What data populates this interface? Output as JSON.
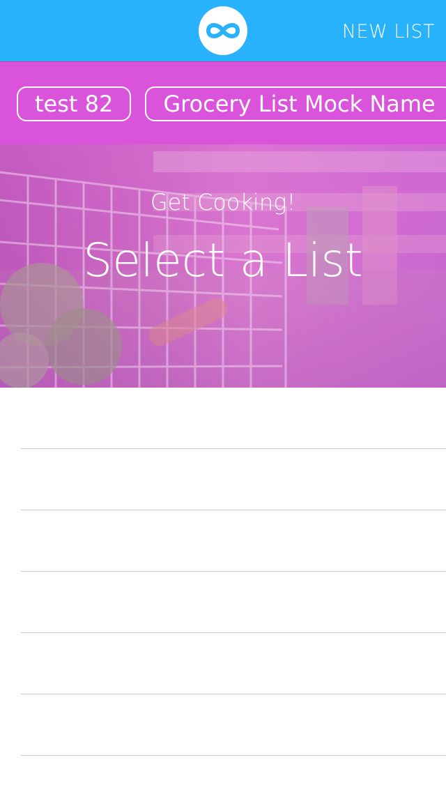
{
  "header": {
    "new_list_label": "NEW LIST",
    "logo_icon": "infinity-icon",
    "background_color": "#27b2fb"
  },
  "chips": {
    "background_color": "#d954db",
    "items": [
      {
        "label": "test 82"
      },
      {
        "label": "Grocery List Mock Name"
      }
    ]
  },
  "hero": {
    "subtitle": "Get Cooking!",
    "title": "Select a List",
    "image": "shopping-cart-photo"
  },
  "list": {
    "rows": [
      "",
      "",
      "",
      "",
      "",
      ""
    ]
  }
}
